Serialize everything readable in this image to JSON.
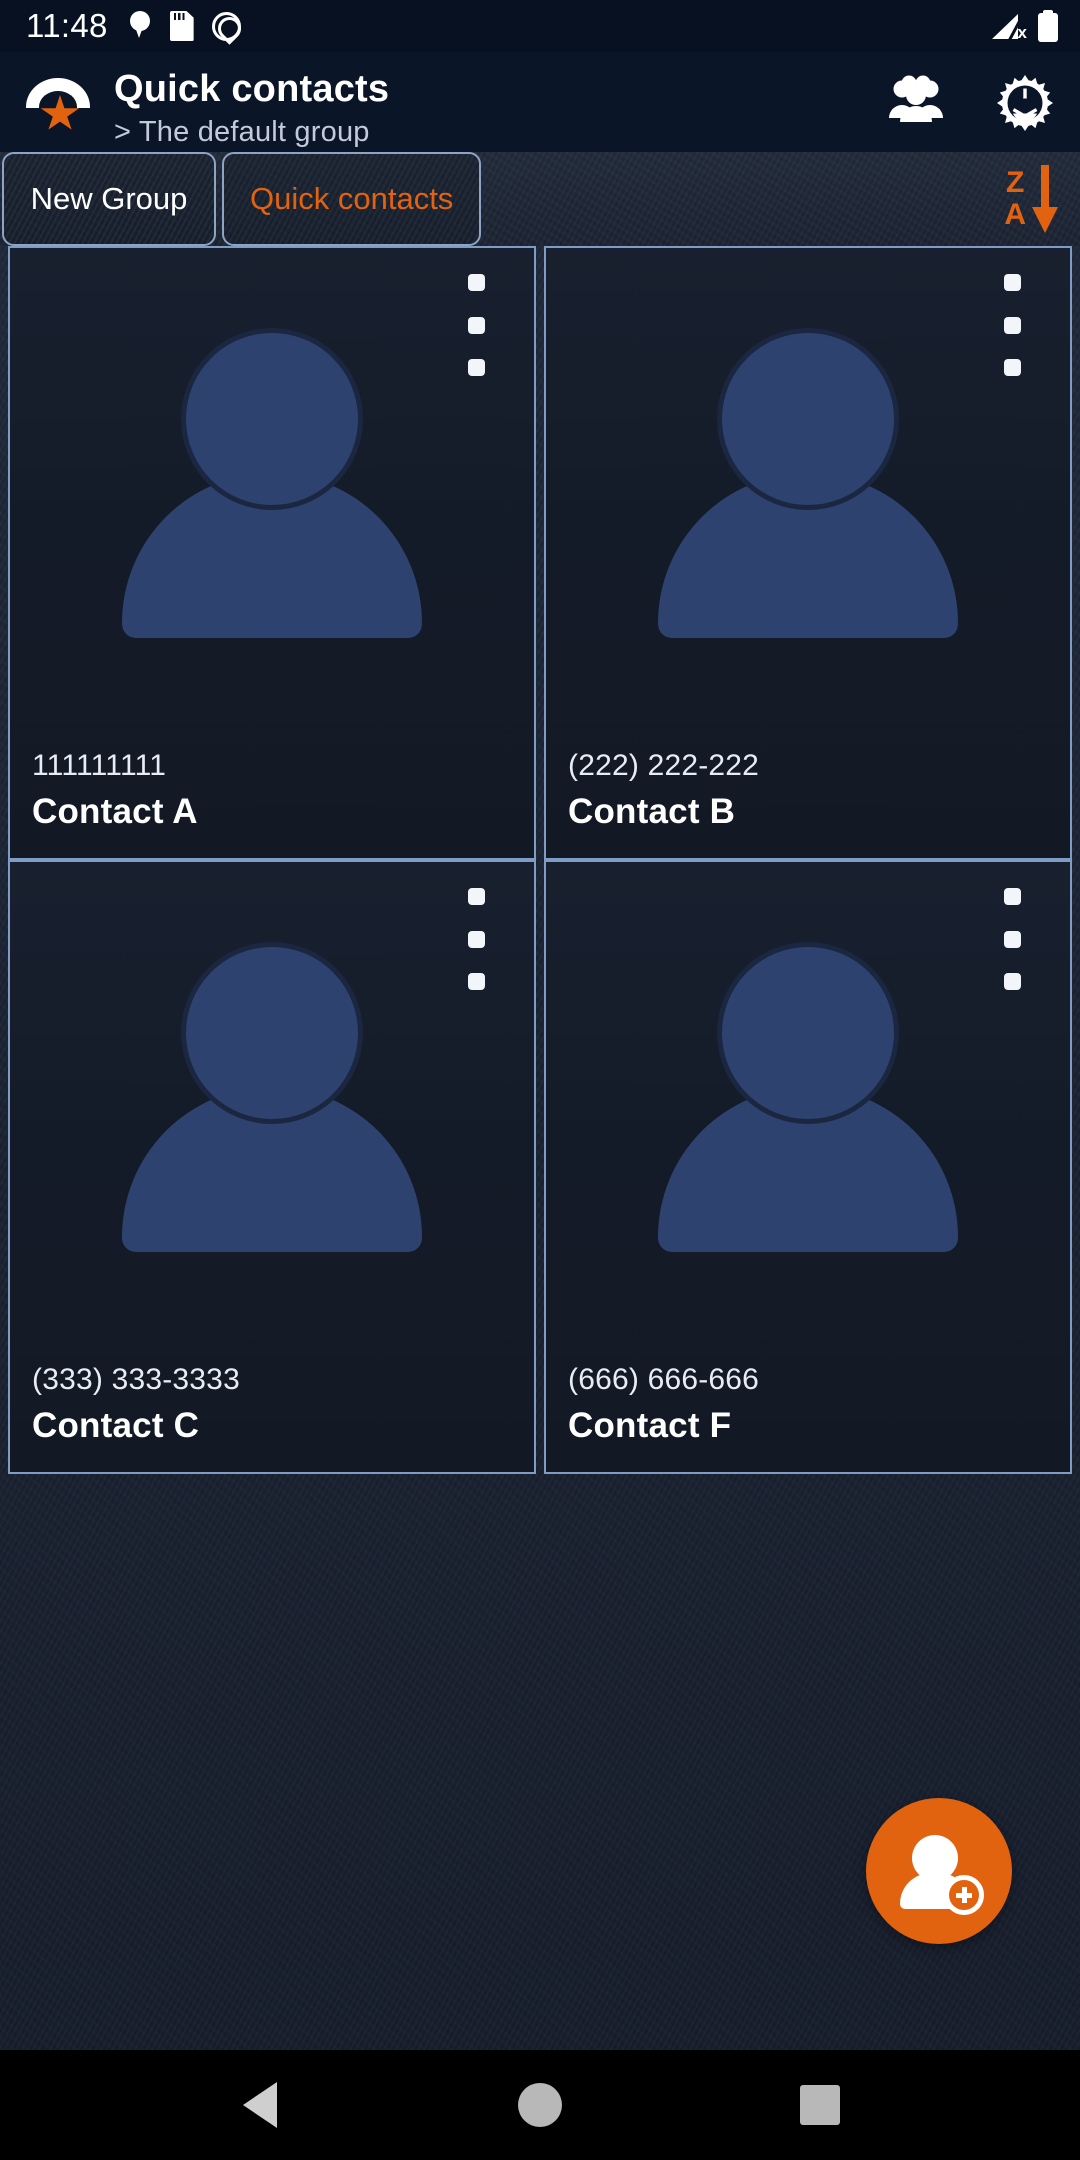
{
  "status_bar": {
    "clock": "11:48",
    "left_icons": [
      "location-pin-icon",
      "sd-card-icon",
      "do-not-disturb-icon"
    ],
    "right_icons": [
      "signal-no-service-icon",
      "battery-full-icon"
    ]
  },
  "app_bar": {
    "logo_icon": "phone-star-icon",
    "title": "Quick contacts",
    "subtitle": "> The default group",
    "actions": [
      {
        "name": "groups-icon",
        "label": "Groups"
      },
      {
        "name": "settings-gear-icon",
        "label": "Settings"
      }
    ]
  },
  "tabs": [
    {
      "label": "New Group",
      "active": false
    },
    {
      "label": "Quick contacts",
      "active": true
    }
  ],
  "sort_control": {
    "top_letter": "Z",
    "bottom_letter": "A",
    "direction_icon": "arrow-down-icon",
    "accent_color": "#e2630f"
  },
  "contacts": [
    {
      "phone": "111111111",
      "name": "Contact A",
      "avatar_icon": "person-placeholder-icon",
      "menu_icon": "overflow-menu-icon"
    },
    {
      "phone": "(222) 222-222",
      "name": "Contact B",
      "avatar_icon": "person-placeholder-icon",
      "menu_icon": "overflow-menu-icon"
    },
    {
      "phone": "(333) 333-3333",
      "name": "Contact C",
      "avatar_icon": "person-placeholder-icon",
      "menu_icon": "overflow-menu-icon"
    },
    {
      "phone": "(666) 666-666",
      "name": "Contact F",
      "avatar_icon": "person-placeholder-icon",
      "menu_icon": "overflow-menu-icon"
    }
  ],
  "fab": {
    "icon": "add-contact-icon",
    "color": "#e2630f"
  },
  "nav_bar": {
    "back_icon": "triangle-back-icon",
    "home_icon": "circle-home-icon",
    "recents_icon": "square-recents-icon"
  },
  "theme": {
    "background": "#1b2433",
    "app_bar_background": "#0b1528",
    "accent": "#e2630f",
    "card_border": "#7f9dc4",
    "avatar_fill": "#2e4270",
    "text_primary": "#ffffff",
    "text_secondary": "#c3cbd9"
  }
}
